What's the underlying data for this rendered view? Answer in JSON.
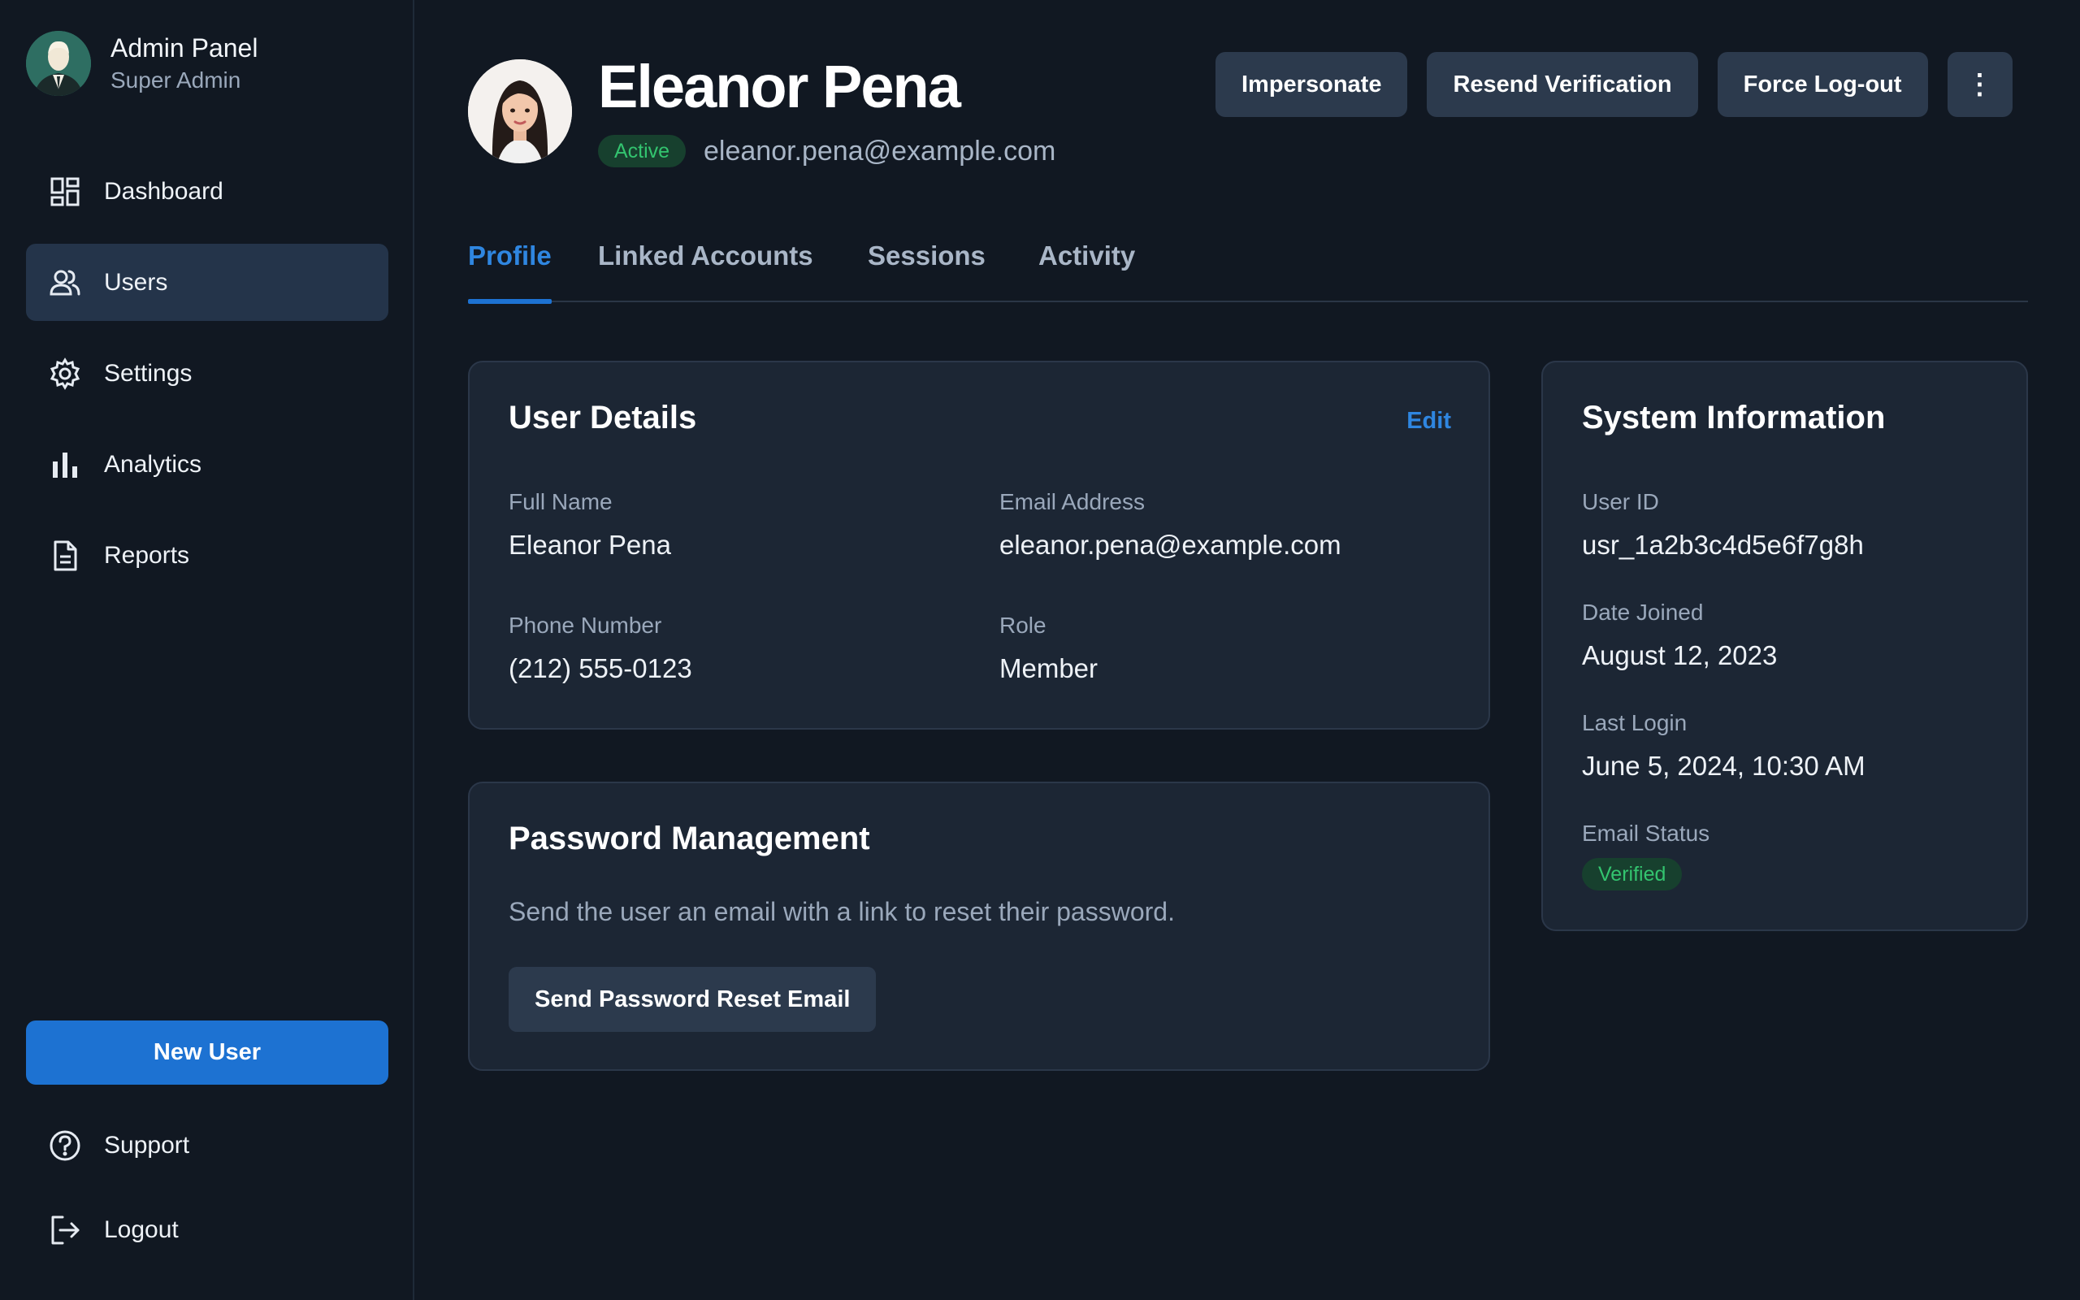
{
  "brand": {
    "title": "Admin Panel",
    "subtitle": "Super Admin"
  },
  "sidebar": {
    "items": [
      {
        "label": "Dashboard",
        "icon": "dashboard-icon",
        "active": false
      },
      {
        "label": "Users",
        "icon": "users-icon",
        "active": true
      },
      {
        "label": "Settings",
        "icon": "gear-icon",
        "active": false
      },
      {
        "label": "Analytics",
        "icon": "bar-chart-icon",
        "active": false
      },
      {
        "label": "Reports",
        "icon": "document-icon",
        "active": false
      }
    ],
    "new_user_label": "New User",
    "bottom_items": [
      {
        "label": "Support",
        "icon": "help-circle-icon"
      },
      {
        "label": "Logout",
        "icon": "logout-icon"
      }
    ]
  },
  "user": {
    "name": "Eleanor Pena",
    "status": "Active",
    "email": "eleanor.pena@example.com"
  },
  "actions": {
    "impersonate": "Impersonate",
    "resend": "Resend Verification",
    "force_logout": "Force Log-out",
    "more": "⋮"
  },
  "tabs": [
    {
      "label": "Profile",
      "active": true
    },
    {
      "label": "Linked Accounts",
      "active": false
    },
    {
      "label": "Sessions",
      "active": false
    },
    {
      "label": "Activity",
      "active": false
    }
  ],
  "user_details": {
    "title": "User Details",
    "edit_label": "Edit",
    "fields": [
      {
        "label": "Full Name",
        "value": "Eleanor Pena"
      },
      {
        "label": "Email Address",
        "value": "eleanor.pena@example.com"
      },
      {
        "label": "Phone Number",
        "value": "(212) 555-0123"
      },
      {
        "label": "Role",
        "value": "Member"
      }
    ]
  },
  "password": {
    "title": "Password Management",
    "description": "Send the user an email with a link to reset their password.",
    "button_label": "Send Password Reset Email"
  },
  "system_info": {
    "title": "System Information",
    "fields": [
      {
        "label": "User ID",
        "value": "usr_1a2b3c4d5e6f7g8h"
      },
      {
        "label": "Date Joined",
        "value": "August 12, 2023"
      },
      {
        "label": "Last Login",
        "value": "June 5, 2024, 10:30 AM"
      }
    ],
    "email_status_label": "Email Status",
    "email_status_value": "Verified"
  },
  "colors": {
    "background": "#111822",
    "accent": "#1d72d2",
    "card": "#1c2634",
    "success": "#33c46f"
  }
}
